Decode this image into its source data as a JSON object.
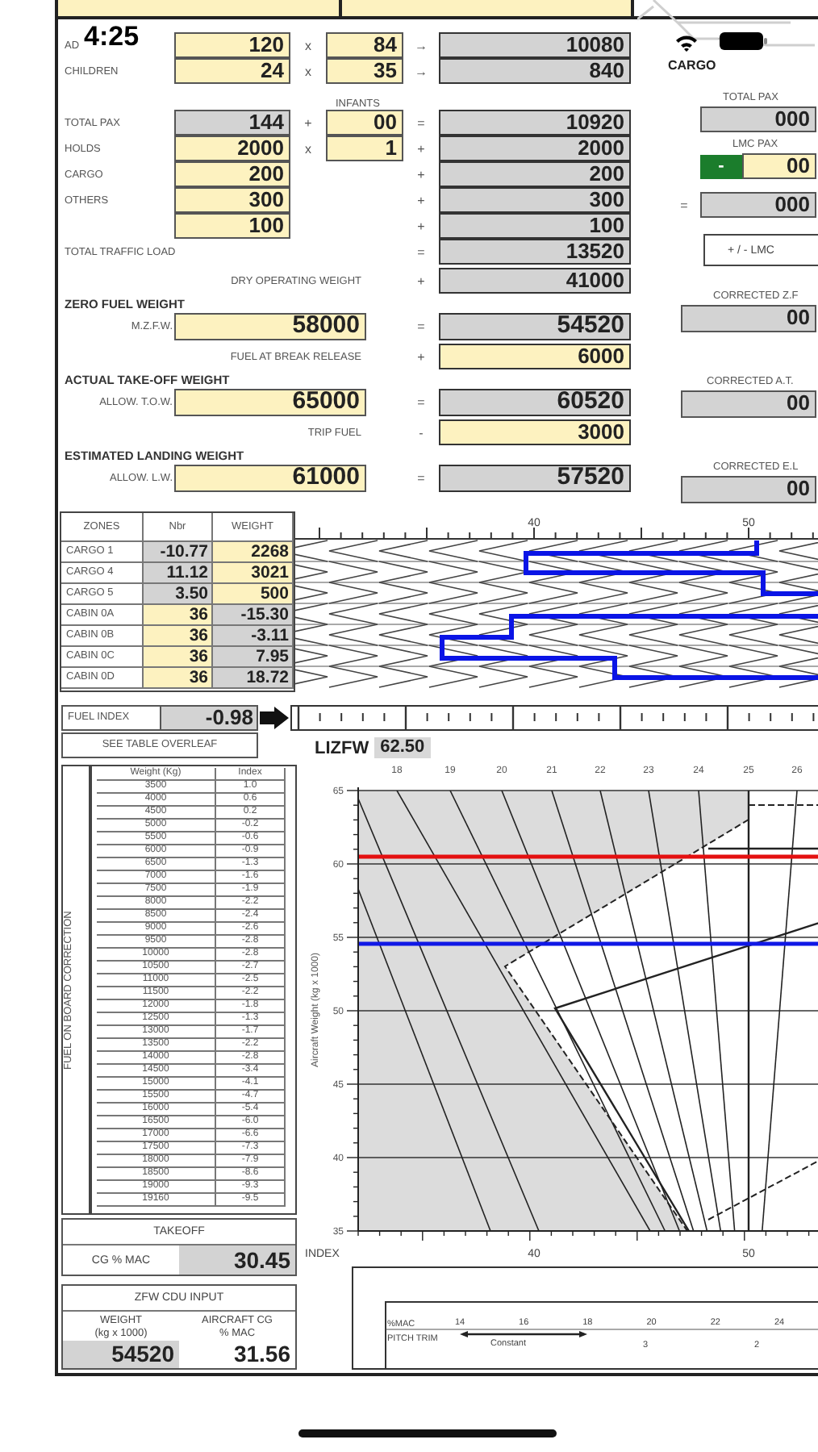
{
  "status_bar": {
    "time": "4:25"
  },
  "top_right": {
    "label": "CARGO"
  },
  "calc_rows": [
    {
      "kind": "calc",
      "label": "AD",
      "a": {
        "value": "120",
        "editable": true
      },
      "op1": "x",
      "b": {
        "value": "84",
        "editable": true
      },
      "op2": "→",
      "result": {
        "value": "10080",
        "editable": false
      }
    },
    {
      "kind": "calc",
      "label": "CHILDREN",
      "a": {
        "value": "24",
        "editable": true
      },
      "op1": "x",
      "b": {
        "value": "35",
        "editable": true
      },
      "op2": "→",
      "result": {
        "value": "840",
        "editable": false
      }
    },
    {
      "kind": "caption",
      "text": "INFANTS"
    },
    {
      "kind": "calc",
      "label": "TOTAL PAX",
      "a": {
        "value": "144",
        "editable": false
      },
      "op1": "+",
      "b": {
        "value": "00",
        "editable": true
      },
      "op2": "=",
      "result": {
        "value": "10920",
        "editable": false
      }
    },
    {
      "kind": "calc",
      "label": "HOLDS",
      "a": {
        "value": "2000",
        "editable": true
      },
      "op1": "x",
      "b": {
        "value": "1",
        "editable": true
      },
      "op2": "+",
      "result": {
        "value": "2000",
        "editable": false
      }
    },
    {
      "kind": "calc",
      "label": "CARGO",
      "a": {
        "value": "200",
        "editable": true
      },
      "op2": "+",
      "result": {
        "value": "200",
        "editable": false
      }
    },
    {
      "kind": "calc",
      "label": "OTHERS",
      "a": {
        "value": "300",
        "editable": true
      },
      "op2": "+",
      "result": {
        "value": "300",
        "editable": false
      }
    },
    {
      "kind": "calc",
      "a": {
        "value": "100",
        "editable": true
      },
      "op2": "+",
      "result": {
        "value": "100",
        "editable": false
      }
    },
    {
      "kind": "calc",
      "label": "TOTAL TRAFFIC LOAD",
      "op2": "=",
      "result": {
        "value": "13520",
        "editable": false
      }
    },
    {
      "kind": "wide",
      "label": "DRY OPERATING WEIGHT",
      "op2": "+",
      "result": {
        "value": "41000",
        "editable": false
      }
    },
    {
      "kind": "heading",
      "label": "ZERO FUEL WEIGHT"
    },
    {
      "kind": "limit",
      "label": "M.Z.F.W.",
      "a": {
        "value": "58000",
        "editable": true
      },
      "op2": "=",
      "result": {
        "value": "54520",
        "editable": false
      }
    },
    {
      "kind": "wide",
      "label": "FUEL AT BREAK RELEASE",
      "op2": "+",
      "result": {
        "value": "6000",
        "editable": true
      }
    },
    {
      "kind": "heading",
      "label": "ACTUAL TAKE-OFF WEIGHT"
    },
    {
      "kind": "limit",
      "label": "ALLOW. T.O.W.",
      "a": {
        "value": "65000",
        "editable": true
      },
      "op2": "=",
      "result": {
        "value": "60520",
        "editable": false
      }
    },
    {
      "kind": "wide",
      "label": "TRIP FUEL",
      "op2": "-",
      "result": {
        "value": "3000",
        "editable": true
      }
    },
    {
      "kind": "heading",
      "label": "ESTIMATED LANDING WEIGHT"
    },
    {
      "kind": "limit",
      "label": "ALLOW. L.W.",
      "a": {
        "value": "61000",
        "editable": true
      },
      "op2": "=",
      "result": {
        "value": "57520",
        "editable": false
      }
    }
  ],
  "lmc": {
    "total_pax_label": "TOTAL PAX",
    "total_pax": "000",
    "lmc_pax_label": "LMC PAX",
    "minus": "-",
    "lmc_pax": "00",
    "equals": "=",
    "result": "000",
    "button": "+ / - LMC",
    "corrected": [
      {
        "label": "CORRECTED Z.F",
        "value": "00"
      },
      {
        "label": "CORRECTED A.T.",
        "value": "00"
      },
      {
        "label": "CORRECTED E.L",
        "value": "00"
      }
    ]
  },
  "zones": {
    "headers": [
      "ZONES",
      "Nbr",
      "WEIGHT"
    ],
    "scale_labels": [
      "40",
      "50"
    ],
    "rows": [
      {
        "zone": "CARGO 1",
        "nbr": {
          "value": "-10.77",
          "editable": false
        },
        "weight": {
          "value": "2268",
          "editable": true
        }
      },
      {
        "zone": "CARGO 4",
        "nbr": {
          "value": "11.12",
          "editable": false
        },
        "weight": {
          "value": "3021",
          "editable": true
        }
      },
      {
        "zone": "CARGO 5",
        "nbr": {
          "value": "3.50",
          "editable": false
        },
        "weight": {
          "value": "500",
          "editable": true
        }
      },
      {
        "zone": "CABIN 0A",
        "nbr": {
          "value": "36",
          "editable": true
        },
        "weight": {
          "value": "-15.30",
          "editable": false
        }
      },
      {
        "zone": "CABIN 0B",
        "nbr": {
          "value": "36",
          "editable": true
        },
        "weight": {
          "value": "-3.11",
          "editable": false
        }
      },
      {
        "zone": "CABIN 0C",
        "nbr": {
          "value": "36",
          "editable": true
        },
        "weight": {
          "value": "7.95",
          "editable": false
        }
      },
      {
        "zone": "CABIN 0D",
        "nbr": {
          "value": "36",
          "editable": true
        },
        "weight": {
          "value": "18.72",
          "editable": false
        }
      }
    ]
  },
  "fuel_index": {
    "label": "FUEL INDEX",
    "value": "-0.98",
    "note": "SEE TABLE OVERLEAF"
  },
  "lizfw": {
    "label": "LIZFW",
    "value": "62.50"
  },
  "fuel_table": {
    "title": "FUEL ON BOARD CORRECTION",
    "headers": [
      "Weight (Kg)",
      "Index"
    ],
    "rows": [
      [
        "3500",
        "1.0"
      ],
      [
        "4000",
        "0.6"
      ],
      [
        "4500",
        "0.2"
      ],
      [
        "5000",
        "-0.2"
      ],
      [
        "5500",
        "-0.6"
      ],
      [
        "6000",
        "-0.9"
      ],
      [
        "6500",
        "-1.3"
      ],
      [
        "7000",
        "-1.6"
      ],
      [
        "7500",
        "-1.9"
      ],
      [
        "8000",
        "-2.2"
      ],
      [
        "8500",
        "-2.4"
      ],
      [
        "9000",
        "-2.6"
      ],
      [
        "9500",
        "-2.8"
      ],
      [
        "10000",
        "-2.8"
      ],
      [
        "10500",
        "-2.7"
      ],
      [
        "11000",
        "-2.5"
      ],
      [
        "11500",
        "-2.2"
      ],
      [
        "12000",
        "-1.8"
      ],
      [
        "12500",
        "-1.3"
      ],
      [
        "13000",
        "-1.7"
      ],
      [
        "13500",
        "-2.2"
      ],
      [
        "14000",
        "-2.8"
      ],
      [
        "14500",
        "-3.4"
      ],
      [
        "15000",
        "-4.1"
      ],
      [
        "15500",
        "-4.7"
      ],
      [
        "16000",
        "-5.4"
      ],
      [
        "16500",
        "-6.0"
      ],
      [
        "17000",
        "-6.6"
      ],
      [
        "17500",
        "-7.3"
      ],
      [
        "18000",
        "-7.9"
      ],
      [
        "18500",
        "-8.6"
      ],
      [
        "19000",
        "-9.3"
      ],
      [
        "19160",
        "-9.5"
      ]
    ]
  },
  "takeoff": {
    "title": "TAKEOFF",
    "label": "CG % MAC",
    "value": "30.45"
  },
  "zfw_cdu": {
    "title": "ZFW CDU INPUT",
    "headers": [
      [
        "WEIGHT",
        "(kg x 1000)"
      ],
      [
        "AIRCRAFT CG",
        "% MAC"
      ]
    ],
    "values": [
      "54520",
      "31.56"
    ]
  },
  "envelope": {
    "top_labels": [
      "18",
      "19",
      "20",
      "21",
      "22",
      "23",
      "24",
      "25",
      "26"
    ],
    "y_labels": [
      "65",
      "60",
      "55",
      "50",
      "45",
      "40",
      "35"
    ],
    "y_title": "Aircraft Weight (kg x 1000)",
    "index_title": "INDEX",
    "index_labels": [
      "40",
      "50"
    ]
  },
  "pitch_trim": {
    "mac_label": "%MAC",
    "mac_ticks": [
      "14",
      "16",
      "18",
      "20",
      "22",
      "24"
    ],
    "trim_label": "PITCH TRIM",
    "constant": "Constant",
    "trim_values": [
      "3",
      "2"
    ]
  }
}
